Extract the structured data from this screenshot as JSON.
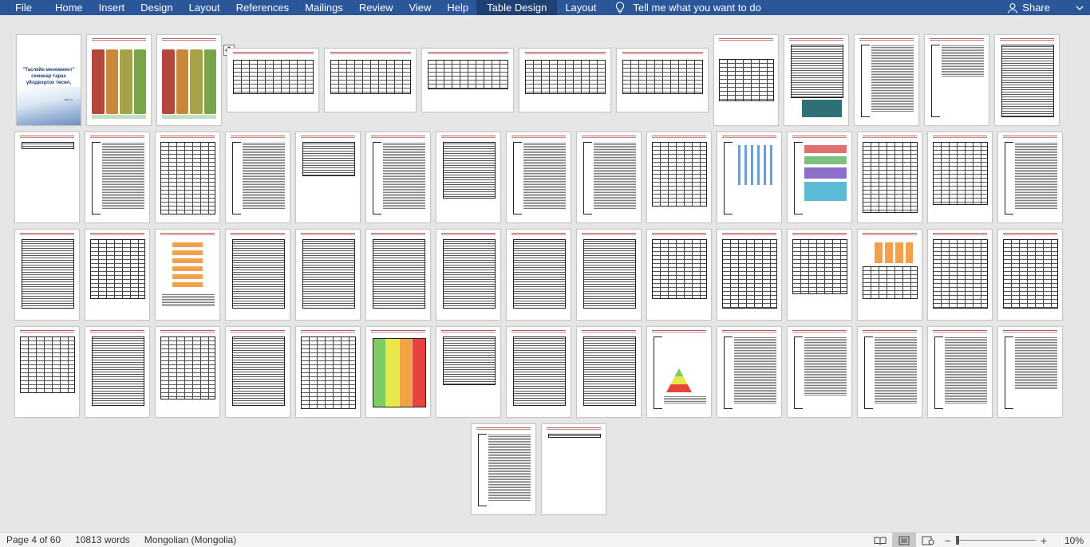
{
  "ribbon": {
    "tabs": [
      "File",
      "Home",
      "Insert",
      "Design",
      "Layout",
      "References",
      "Mailings",
      "Review",
      "View",
      "Help",
      "Table Design",
      "Layout"
    ],
    "tell_me": "Tell me what you want to do",
    "share": "Share",
    "accent_color": "#2b579a"
  },
  "cover": {
    "title": "\"Таслейн менежмент\" семинар тарах үйлдвэрлэх төсөл,",
    "year": "2023 он"
  },
  "status": {
    "page": "Page 4 of 60",
    "words": "10813 words",
    "language": "Mongolian (Mongolia)",
    "zoom": "10%"
  },
  "view_buttons": [
    "read-mode",
    "print-layout",
    "web-layout"
  ]
}
